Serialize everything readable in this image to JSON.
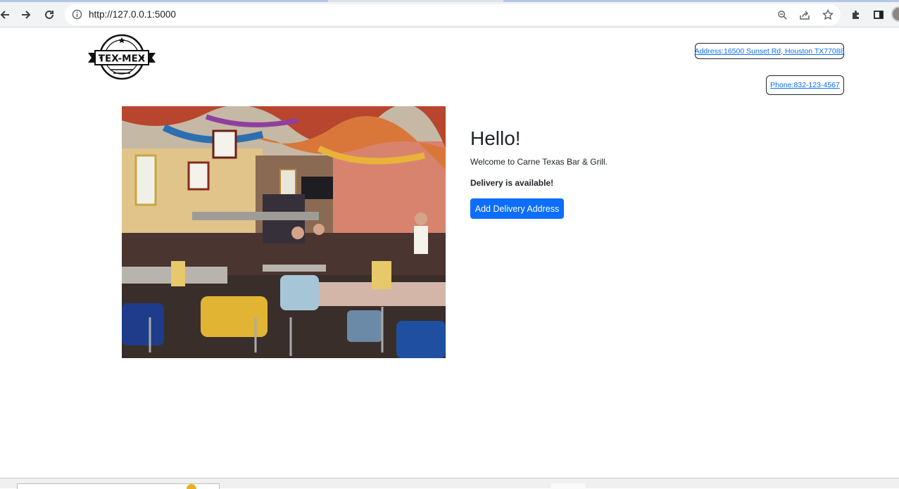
{
  "browser": {
    "url": "http://127.0.0.1:5000",
    "icons": [
      "back-icon",
      "forward-icon",
      "reload-icon",
      "info-icon",
      "zoom-icon",
      "share-icon",
      "bookmark-star-icon",
      "extensions-icon",
      "side-panel-icon",
      "profile-avatar"
    ]
  },
  "header": {
    "logo_text": "TEX-MEX",
    "address_link": "Address:16500 Sunset Rd, Houston TX77088",
    "phone_link": "Phone:832-123-4567"
  },
  "hero": {
    "heading": "Hello!",
    "welcome": "Welcome to Carne Texas Bar & Grill.",
    "delivery": "Delivery is available!",
    "cta_label": "Add Delivery Address"
  },
  "colors": {
    "primary": "#0d6efd",
    "text": "#212529",
    "chrome": "#dee1e6"
  }
}
